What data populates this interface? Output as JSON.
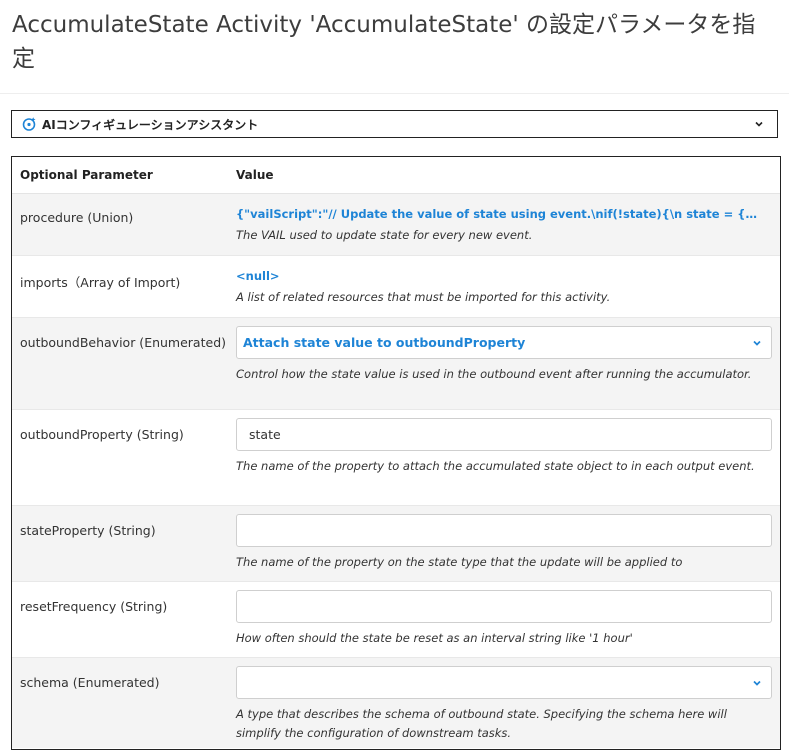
{
  "page": {
    "title": "AccumulateState Activity 'AccumulateState' の設定パラメータを指定"
  },
  "assistant": {
    "label": "AIコンフィギュレーションアシスタント"
  },
  "table": {
    "col_param": "Optional Parameter",
    "col_value": "Value"
  },
  "params": {
    "procedure": {
      "name": "procedure (Union)",
      "value": "{\"vailScript\":\"// Update the value of state using event.\\nif(!state){\\n state = {}\\n}\\nif(...",
      "desc": "The VAIL used to update state for every new event."
    },
    "imports": {
      "name": "imports（Array of Import)",
      "value": "<null>",
      "desc": "A list of related resources that must be imported for this activity."
    },
    "outboundBehavior": {
      "name": "outboundBehavior (Enumerated)",
      "value": "Attach state value to outboundProperty",
      "desc": "Control how the state value is used in the outbound event after running the accumulator."
    },
    "outboundProperty": {
      "name": "outboundProperty (String)",
      "value": "state",
      "desc": "The name of the property to attach the accumulated state object to in each output event."
    },
    "stateProperty": {
      "name": "stateProperty (String)",
      "value": "",
      "desc": "The name of the property on the state type that the update will be applied to"
    },
    "resetFrequency": {
      "name": "resetFrequency (String)",
      "value": "",
      "desc": "How often should the state be reset as an interval string like '1 hour'"
    },
    "schema": {
      "name": "schema (Enumerated)",
      "value": "",
      "desc": "A type that describes the schema of outbound state. Specifying the schema here will simplify the configuration of downstream tasks."
    }
  },
  "colors": {
    "link": "#1e84d6",
    "alt_row": "#f4f4f4",
    "border": "#222222"
  },
  "icons": {
    "assistant": "ai-assistant-icon",
    "dropdown": "chevron-down-icon"
  }
}
